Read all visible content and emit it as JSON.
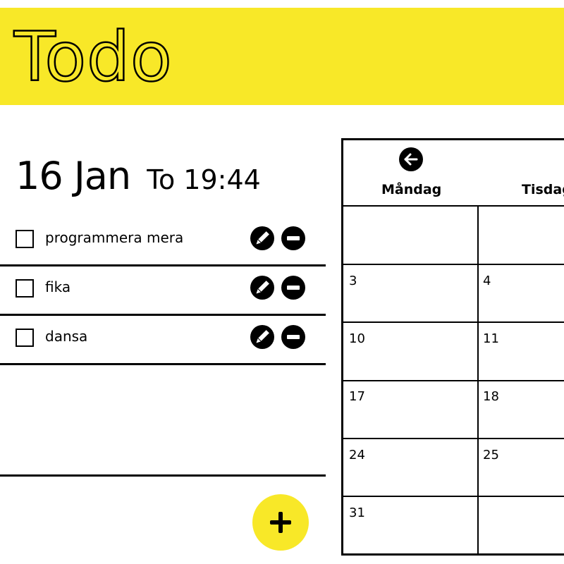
{
  "app": {
    "title": "Todo"
  },
  "date": {
    "day_month": "16 Jan",
    "weekday_time": "To 19:44"
  },
  "todos": [
    {
      "label": "programmera mera",
      "checked": false
    },
    {
      "label": "fika",
      "checked": false
    },
    {
      "label": "dansa",
      "checked": false
    }
  ],
  "icons": {
    "edit": "pencil-icon",
    "remove": "minus-circle-icon",
    "add": "plus-icon",
    "back": "arrow-left-icon"
  },
  "colors": {
    "accent": "#f8e828",
    "text": "#000000",
    "background": "#ffffff"
  },
  "calendar": {
    "weekdays": [
      "Måndag",
      "Tisdag"
    ],
    "days": [
      [
        "",
        ""
      ],
      [
        "3",
        "4"
      ],
      [
        "10",
        "11"
      ],
      [
        "17",
        "18"
      ],
      [
        "24",
        "25"
      ],
      [
        "31",
        ""
      ]
    ]
  }
}
